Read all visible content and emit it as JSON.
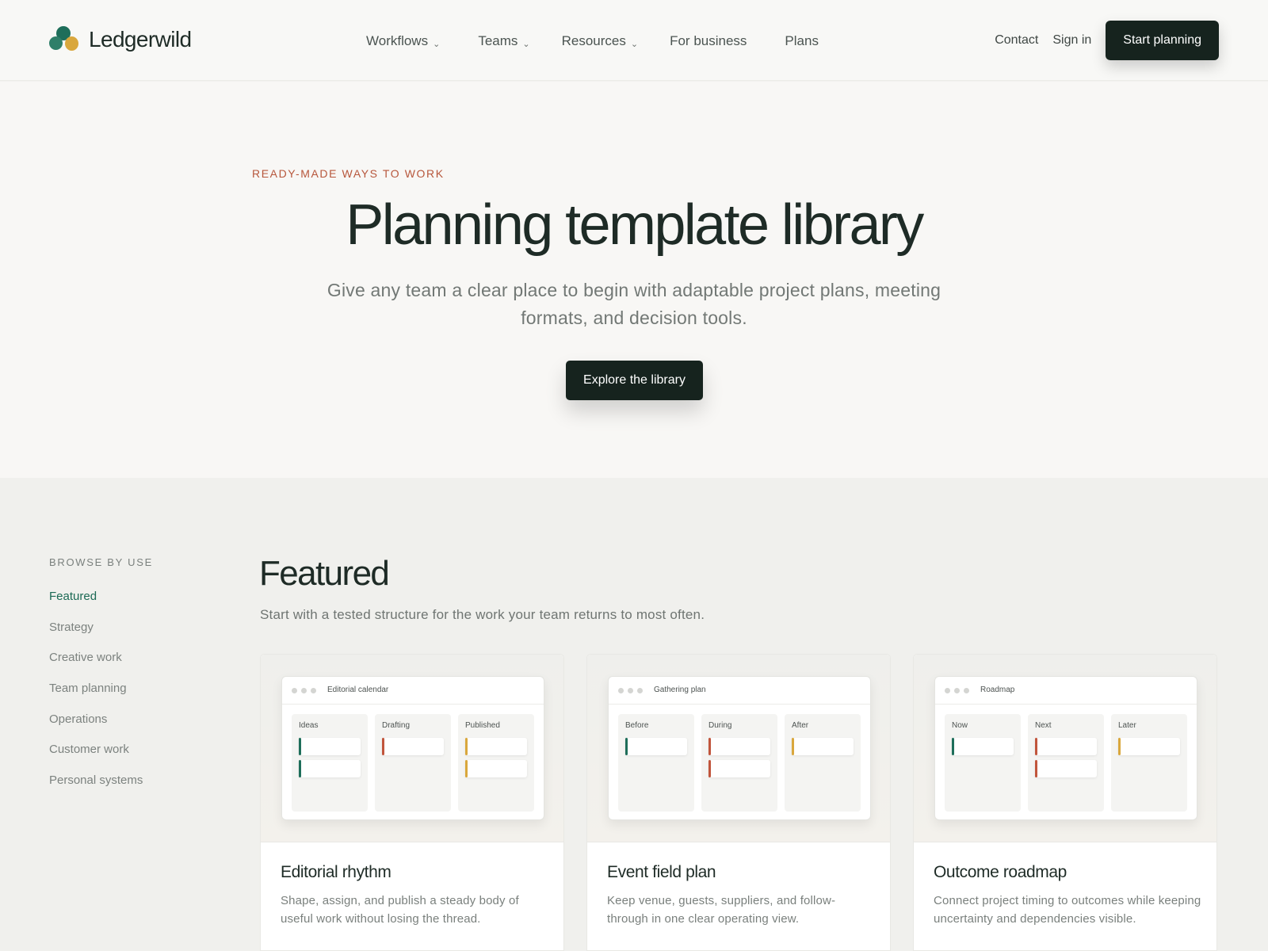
{
  "brand": {
    "name": "Ledgerwild",
    "colors": {
      "teal": "#1e6e5a",
      "gold": "#d9a73d",
      "red": "#c1553c",
      "dark": "#16231e"
    }
  },
  "nav": {
    "items": [
      {
        "label": "Workflows",
        "icon": "chevron-down-icon",
        "chevron": "⌄"
      },
      {
        "label": "Teams",
        "icon": "chevron-down-icon",
        "chevron": "⌄"
      },
      {
        "label": "Resources",
        "icon": "chevron-down-icon",
        "chevron": "⌄"
      },
      {
        "label": "For business"
      },
      {
        "label": "Plans"
      }
    ],
    "contact": "Contact",
    "sign_in": "Sign in",
    "cta": "Start planning"
  },
  "hero": {
    "eyebrow": "READY-MADE WAYS TO WORK",
    "title": "Planning template library",
    "subtitle": "Give any team a clear place to begin with adaptable project plans, meeting formats, and decision tools.",
    "cta": "Explore the library"
  },
  "sidebar": {
    "title": "BROWSE BY USE",
    "items": [
      {
        "label": "Featured",
        "active": true
      },
      {
        "label": "Strategy"
      },
      {
        "label": "Creative work"
      },
      {
        "label": "Team planning"
      },
      {
        "label": "Operations"
      },
      {
        "label": "Customer work"
      },
      {
        "label": "Personal systems"
      }
    ]
  },
  "section": {
    "title": "Featured",
    "subtitle": "Start with a tested structure for the work your team returns to most often."
  },
  "cards": [
    {
      "window_title": "Editorial calendar",
      "columns": [
        {
          "label": "Ideas",
          "tasks": [
            "#1e6e5a",
            "#1e6e5a"
          ]
        },
        {
          "label": "Drafting",
          "tasks": [
            "#c1553c"
          ]
        },
        {
          "label": "Published",
          "tasks": [
            "#d9a73d",
            "#d9a73d"
          ]
        }
      ],
      "title": "Editorial rhythm",
      "description": "Shape, assign, and publish a steady body of useful work without losing the thread."
    },
    {
      "window_title": "Gathering plan",
      "columns": [
        {
          "label": "Before",
          "tasks": [
            "#1e6e5a"
          ]
        },
        {
          "label": "During",
          "tasks": [
            "#c1553c",
            "#c1553c"
          ]
        },
        {
          "label": "After",
          "tasks": [
            "#d9a73d"
          ]
        }
      ],
      "title": "Event field plan",
      "description": "Keep venue, guests, suppliers, and follow-through in one clear operating view."
    },
    {
      "window_title": "Roadmap",
      "columns": [
        {
          "label": "Now",
          "tasks": [
            "#1e6e5a"
          ]
        },
        {
          "label": "Next",
          "tasks": [
            "#c1553c",
            "#c1553c"
          ]
        },
        {
          "label": "Later",
          "tasks": [
            "#d9a73d"
          ]
        }
      ],
      "title": "Outcome roadmap",
      "description": "Connect project timing to outcomes while keeping uncertainty and dependencies visible."
    }
  ]
}
